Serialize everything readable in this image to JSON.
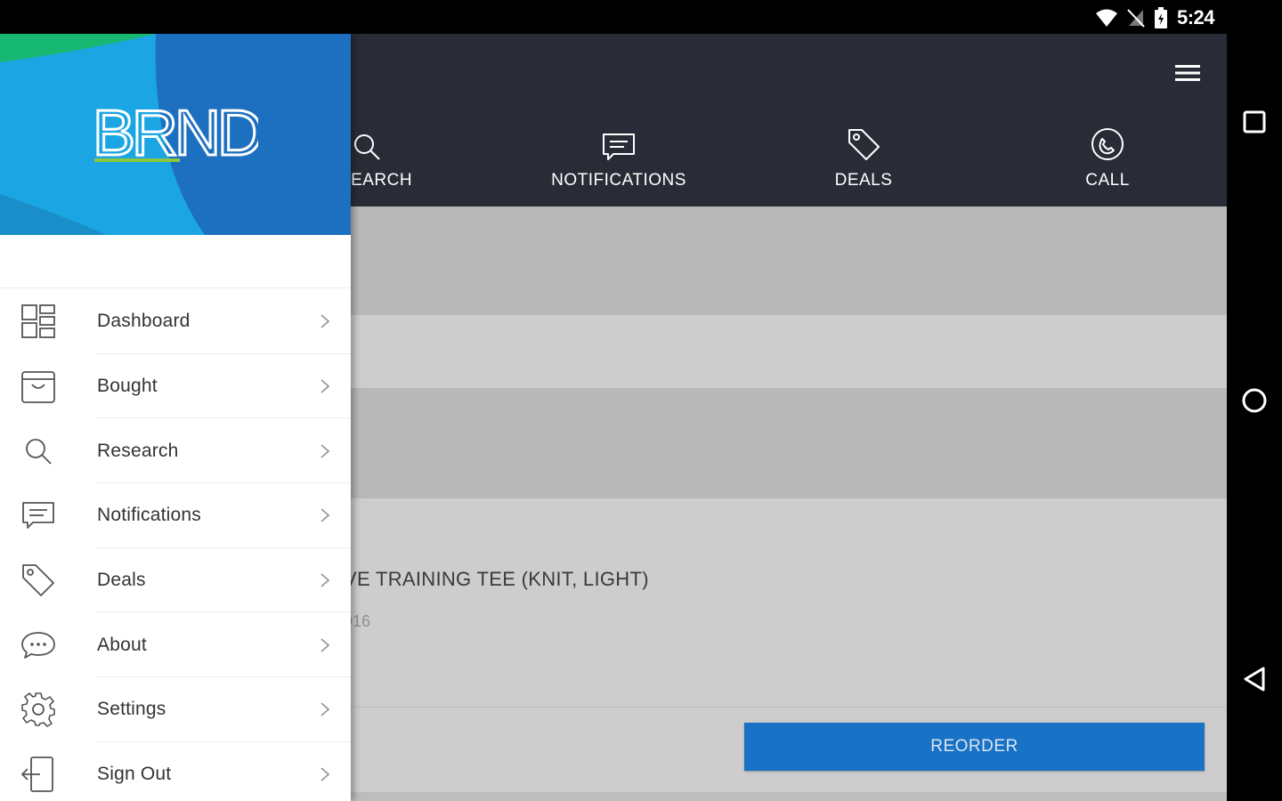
{
  "status_bar": {
    "time": "5:24"
  },
  "header": {
    "tabs": [
      {
        "label": "SEARCH",
        "icon": "search-icon"
      },
      {
        "label": "NOTIFICATIONS",
        "icon": "message-icon"
      },
      {
        "label": "DEALS",
        "icon": "tag-icon"
      },
      {
        "label": "CALL",
        "icon": "phone-icon"
      }
    ]
  },
  "product": {
    "name": "VE TRAINING TEE (KNIT, LIGHT)",
    "date": "016",
    "reorder_label": "REORDER"
  },
  "drawer": {
    "logo_text": "BRND",
    "items": [
      {
        "label": "Dashboard",
        "icon": "dashboard-icon"
      },
      {
        "label": "Bought",
        "icon": "cart-icon"
      },
      {
        "label": "Research",
        "icon": "search-icon"
      },
      {
        "label": "Notifications",
        "icon": "message-icon"
      },
      {
        "label": "Deals",
        "icon": "tag-icon"
      },
      {
        "label": "About",
        "icon": "chat-bubble-icon"
      },
      {
        "label": "Settings",
        "icon": "gear-icon"
      },
      {
        "label": "Sign Out",
        "icon": "sign-out-icon"
      }
    ]
  },
  "colors": {
    "header_bg": "#292c36",
    "accent": "#1a72c6",
    "logo_cyan": "#1ba6e3",
    "logo_blue": "#1d6fc0",
    "logo_green": "#17b872"
  }
}
